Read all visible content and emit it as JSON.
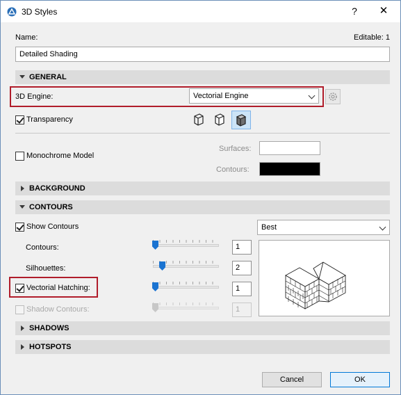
{
  "window": {
    "title": "3D Styles",
    "help_glyph": "?",
    "close_glyph": "✕"
  },
  "name_label": "Name:",
  "editable_label": "Editable: 1",
  "name_value": "Detailed Shading",
  "general": {
    "title": "GENERAL",
    "engine_label": "3D Engine:",
    "engine_value": "Vectorial Engine",
    "transparency_label": "Transparency",
    "transparency_checked": true,
    "monochrome_label": "Monochrome Model",
    "monochrome_checked": false,
    "surfaces_label": "Surfaces:",
    "contours_label": "Contours:",
    "surfaces_color": "#ffffff",
    "contours_color": "#000000"
  },
  "background": {
    "title": "BACKGROUND"
  },
  "contours": {
    "title": "CONTOURS",
    "show_label": "Show Contours",
    "show_checked": true,
    "quality_value": "Best",
    "contours_label": "Contours:",
    "contours_value": "1",
    "contours_level": 0.0,
    "silhouettes_label": "Silhouettes:",
    "silhouettes_value": "2",
    "silhouettes_level": 0.1,
    "hatching_label": "Vectorial Hatching:",
    "hatching_checked": true,
    "hatching_value": "1",
    "hatching_level": 0.0,
    "shadow_label": "Shadow Contours:",
    "shadow_checked": false,
    "shadow_value": "1",
    "shadow_level": 0.0
  },
  "shadows": {
    "title": "SHADOWS"
  },
  "hotspots": {
    "title": "HOTSPOTS"
  },
  "buttons": {
    "cancel": "Cancel",
    "ok": "OK"
  },
  "colors": {
    "accent": "#1a73d1",
    "highlight_border": "#b01c2a",
    "section_bg": "#dcdcdc"
  }
}
